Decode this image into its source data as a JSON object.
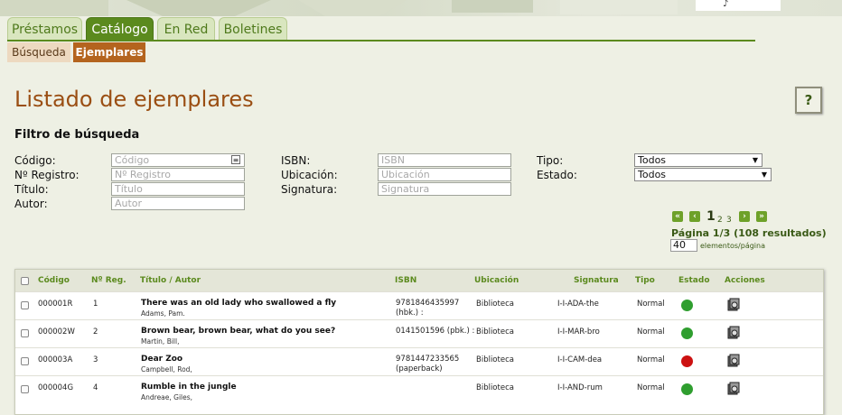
{
  "tabs": [
    {
      "label": "Préstamos"
    },
    {
      "label": "Catálogo"
    },
    {
      "label": "En Red"
    },
    {
      "label": "Boletines"
    }
  ],
  "subtabs": [
    {
      "label": "Búsqueda"
    },
    {
      "label": "Ejemplares"
    }
  ],
  "page_title": "Listado de ejemplares",
  "help_label": "?",
  "filter": {
    "title": "Filtro de búsqueda",
    "codigo_label": "Código:",
    "codigo_placeholder": "Código",
    "registro_label": "Nº Registro:",
    "registro_placeholder": "Nº Registro",
    "titulo_label": "Título:",
    "titulo_placeholder": "Título",
    "autor_label": "Autor:",
    "autor_placeholder": "Autor",
    "isbn_label": "ISBN:",
    "isbn_placeholder": "ISBN",
    "ubicacion_label": "Ubicación:",
    "ubicacion_placeholder": "Ubicación",
    "signatura_label": "Signatura:",
    "signatura_placeholder": "Signatura",
    "tipo_label": "Tipo:",
    "tipo_value": "Todos",
    "estado_label": "Estado:",
    "estado_value": "Todos"
  },
  "pagination": {
    "current": "1",
    "pages": [
      "2",
      "3"
    ],
    "info": "Página 1/3 (108 resultados)",
    "per_page": "40",
    "per_page_label": "elementos/página"
  },
  "table": {
    "headers": {
      "codigo": "Código",
      "registro": "Nº Reg.",
      "titulo": "Título / Autor",
      "isbn": "ISBN",
      "ubicacion": "Ubicación",
      "signatura": "Signatura",
      "tipo": "Tipo",
      "estado": "Estado",
      "acciones": "Acciones"
    },
    "rows": [
      {
        "codigo": "000001R",
        "registro": "1",
        "titulo": "There was an old lady who swallowed a fly",
        "autor": "Adams, Pam.",
        "isbn": "9781846435997",
        "isbn2": "(hbk.) :",
        "ubicacion": "Biblioteca",
        "signatura": "I-I-ADA-the",
        "tipo": "Normal",
        "estado": "available"
      },
      {
        "codigo": "000002W",
        "registro": "2",
        "titulo": "Brown bear, brown bear, what do you see?",
        "autor": "Martin, Bill,",
        "isbn": "0141501596 (pbk.) :",
        "isbn2": "",
        "ubicacion": "Biblioteca",
        "signatura": "I-I-MAR-bro",
        "tipo": "Normal",
        "estado": "available"
      },
      {
        "codigo": "000003A",
        "registro": "3",
        "titulo": "Dear Zoo",
        "autor": "Campbell, Rod,",
        "isbn": "9781447233565",
        "isbn2": "(paperback)",
        "ubicacion": "Biblioteca",
        "signatura": "I-I-CAM-dea",
        "tipo": "Normal",
        "estado": "unavailable"
      },
      {
        "codigo": "000004G",
        "registro": "4",
        "titulo": "Rumble in the jungle",
        "autor": "Andreae, Giles,",
        "isbn": "",
        "isbn2": "",
        "ubicacion": "Biblioteca",
        "signatura": "I-I-AND-rum",
        "tipo": "Normal",
        "estado": "available"
      }
    ]
  },
  "colors": {
    "available": "#2f9e2f",
    "unavailable": "#cc1111",
    "accent": "#5b8a1e",
    "title": "#9a4e13"
  }
}
